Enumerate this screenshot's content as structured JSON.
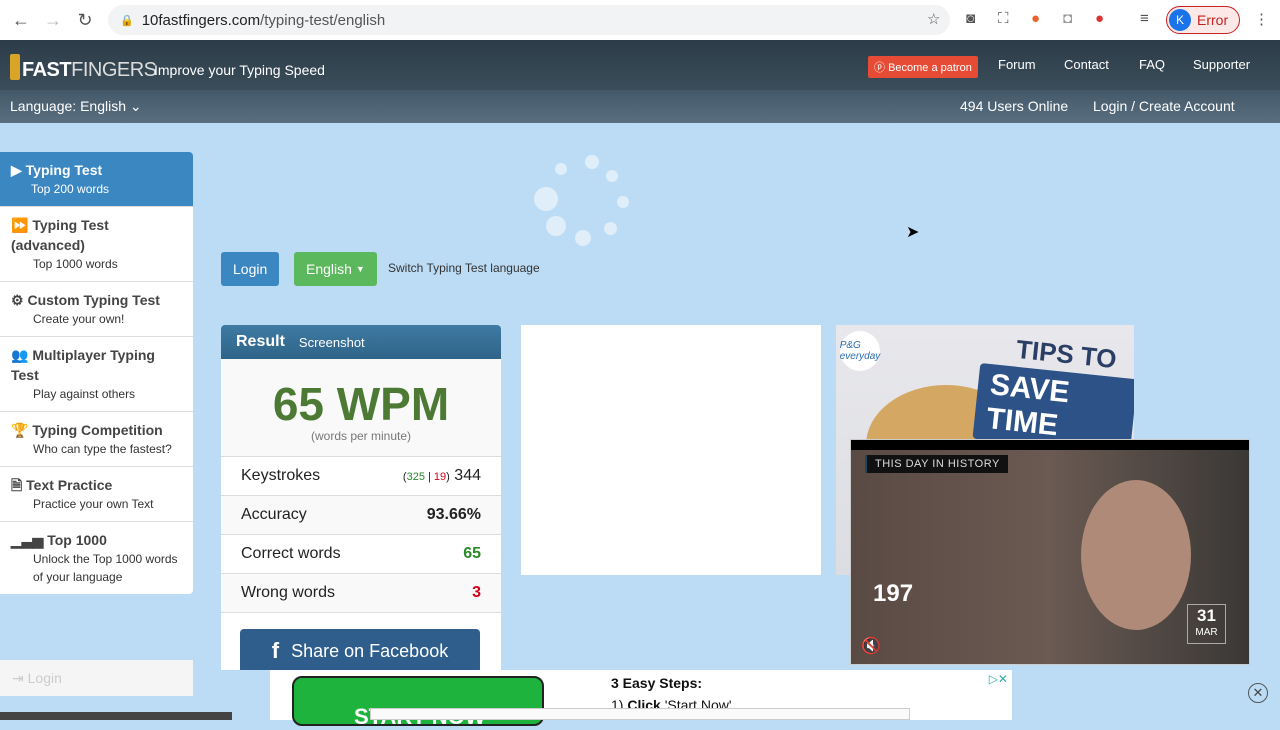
{
  "browser": {
    "url_domain": "10fastfingers.com",
    "url_path": "/typing-test/english",
    "profile_initial": "K",
    "profile_status": "Error"
  },
  "header": {
    "logo_bold": "FAST",
    "logo_thin": "FINGERS",
    "tagline": "Improve your Typing Speed",
    "patron": "Become a patron",
    "links": [
      "Forum",
      "Contact",
      "FAQ",
      "Supporter"
    ],
    "language": "Language: English",
    "users_online": "494 Users Online",
    "login": "Login / Create Account"
  },
  "sidebar": {
    "items": [
      {
        "title": "Typing Test",
        "desc": "Top 200 words",
        "icon": "play-icon",
        "active": true
      },
      {
        "title": "Typing Test (advanced)",
        "desc": "Top 1000 words",
        "icon": "fast-forward-icon"
      },
      {
        "title": "Custom Typing Test",
        "desc": "Create your own!",
        "icon": "gears-icon"
      },
      {
        "title": "Multiplayer Typing Test",
        "desc": "Play against others",
        "icon": "users-icon"
      },
      {
        "title": "Typing Competition",
        "desc": "Who can type the fastest?",
        "icon": "trophy-icon"
      },
      {
        "title": "Text Practice",
        "desc": "Practice your own Text",
        "icon": "file-text-icon"
      },
      {
        "title": "Top 1000",
        "desc": "Unlock the Top 1000 words of your language",
        "icon": "signal-icon"
      }
    ],
    "login": "Login"
  },
  "controls": {
    "login": "Login",
    "language": "English",
    "switch_text": "Switch Typing Test language"
  },
  "result": {
    "tab_result": "Result",
    "tab_screenshot": "Screenshot",
    "wpm": "65 WPM",
    "wpm_unit": "(words per minute)",
    "keystrokes_label": "Keystrokes",
    "keystrokes_correct": "325",
    "keystrokes_wrong": "19",
    "keystrokes_total": "344",
    "accuracy_label": "Accuracy",
    "accuracy": "93.66%",
    "correct_label": "Correct words",
    "correct": "65",
    "wrong_label": "Wrong words",
    "wrong": "3",
    "share": "Share on Facebook"
  },
  "ads": {
    "pg_logo": "P&G everyday",
    "tips": "TIPS TO",
    "save": "SAVE TIME",
    "video_tag": "THIS DAY IN HISTORY",
    "video_number": "197",
    "video_day": "31",
    "video_month": "MAR",
    "start": "START NOW",
    "steps_title": "3 Easy Steps:",
    "step1_bold": "Click",
    "step1_rest": " 'Start Now'"
  },
  "colors": {
    "accent": "#3a87c2",
    "green": "#4c7a34",
    "red": "#d0021b",
    "patron": "#e64b36",
    "facebook": "#2f5e8c"
  }
}
